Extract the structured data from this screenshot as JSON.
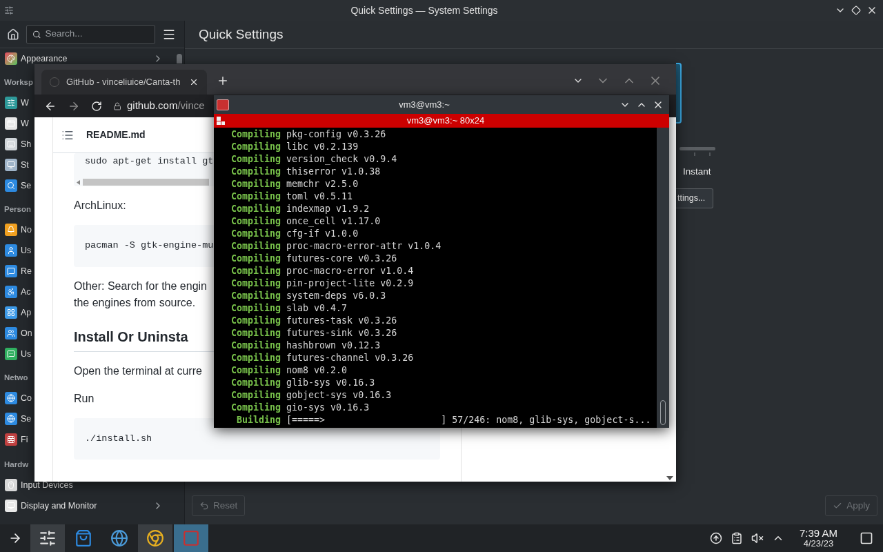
{
  "settings_window": {
    "title": "Quick Settings — System Settings",
    "search_placeholder": "Search...",
    "page_title": "Quick Settings",
    "sidebar": [
      {
        "kind": "item",
        "label": "Appearance",
        "chevron": true
      },
      {
        "kind": "heading",
        "label": "Worksp"
      },
      {
        "kind": "item",
        "label": "W"
      },
      {
        "kind": "item",
        "label": "W"
      },
      {
        "kind": "item",
        "label": "Sh"
      },
      {
        "kind": "item",
        "label": "St"
      },
      {
        "kind": "item",
        "label": "Se"
      },
      {
        "kind": "heading",
        "label": "Person"
      },
      {
        "kind": "item",
        "label": "No"
      },
      {
        "kind": "item",
        "label": "Us"
      },
      {
        "kind": "item",
        "label": "Re"
      },
      {
        "kind": "item",
        "label": "Ac"
      },
      {
        "kind": "item",
        "label": "Ap"
      },
      {
        "kind": "item",
        "label": "On"
      },
      {
        "kind": "item",
        "label": "Us"
      },
      {
        "kind": "heading",
        "label": "Netwo"
      },
      {
        "kind": "item",
        "label": "Co"
      },
      {
        "kind": "item",
        "label": "Se"
      },
      {
        "kind": "item",
        "label": "Fi"
      },
      {
        "kind": "heading",
        "label": "Hardw"
      },
      {
        "kind": "item",
        "label": "Input Devices"
      },
      {
        "kind": "item",
        "label": "Display and Monitor",
        "chevron": true
      }
    ],
    "slider_end_label": "Instant",
    "settings_button": "ttings...",
    "reset_button": {
      "label": "Reset",
      "disabled": true
    },
    "apply_button": {
      "label": "Apply",
      "disabled": true
    }
  },
  "browser": {
    "tab_title": "GitHub - vinceliuice/Canta-th",
    "url_host": "github.com",
    "url_path": "/vince",
    "file_header": "README.md",
    "blocks": [
      {
        "kind": "code",
        "text": "sudo apt-get install gt",
        "scroll": true
      },
      {
        "kind": "paragraph",
        "lines": [
          "ArchLinux:"
        ]
      },
      {
        "kind": "code",
        "text": "pacman -S gtk-engine-mu"
      },
      {
        "kind": "paragraph",
        "lines": [
          "Other: Search for the engin",
          "the engines from source."
        ]
      },
      {
        "kind": "heading",
        "text": "Install Or Uninsta"
      },
      {
        "kind": "paragraph",
        "lines": [
          "Open the terminal at curre"
        ]
      },
      {
        "kind": "paragraph",
        "lines": [
          "Run"
        ]
      },
      {
        "kind": "code",
        "text": "./install.sh"
      }
    ]
  },
  "terminal": {
    "title": "vm3@vm3:~",
    "tab_title": "vm3@vm3:~ 80x24",
    "lines": [
      {
        "verb": "Compiling",
        "text": "pkg-config v0.3.26"
      },
      {
        "verb": "Compiling",
        "text": "libc v0.2.139"
      },
      {
        "verb": "Compiling",
        "text": "version_check v0.9.4"
      },
      {
        "verb": "Compiling",
        "text": "thiserror v1.0.38"
      },
      {
        "verb": "Compiling",
        "text": "memchr v2.5.0"
      },
      {
        "verb": "Compiling",
        "text": "toml v0.5.11"
      },
      {
        "verb": "Compiling",
        "text": "indexmap v1.9.2"
      },
      {
        "verb": "Compiling",
        "text": "once_cell v1.17.0"
      },
      {
        "verb": "Compiling",
        "text": "cfg-if v1.0.0"
      },
      {
        "verb": "Compiling",
        "text": "proc-macro-error-attr v1.0.4"
      },
      {
        "verb": "Compiling",
        "text": "futures-core v0.3.26"
      },
      {
        "verb": "Compiling",
        "text": "proc-macro-error v1.0.4"
      },
      {
        "verb": "Compiling",
        "text": "pin-project-lite v0.2.9"
      },
      {
        "verb": "Compiling",
        "text": "system-deps v6.0.3"
      },
      {
        "verb": "Compiling",
        "text": "slab v0.4.7"
      },
      {
        "verb": "Compiling",
        "text": "futures-task v0.3.26"
      },
      {
        "verb": "Compiling",
        "text": "futures-sink v0.3.26"
      },
      {
        "verb": "Compiling",
        "text": "hashbrown v0.12.3"
      },
      {
        "verb": "Compiling",
        "text": "futures-channel v0.3.26"
      },
      {
        "verb": "Compiling",
        "text": "nom8 v0.2.0"
      },
      {
        "verb": "Compiling",
        "text": "glib-sys v0.16.3"
      },
      {
        "verb": "Compiling",
        "text": "gobject-sys v0.16.3"
      },
      {
        "verb": "Compiling",
        "text": "gio-sys v0.16.3"
      }
    ],
    "build": {
      "verb": "Building",
      "bar": "[=====>                     ]",
      "status": "57/246: nom8, glib-sys, gobject-s..."
    }
  },
  "taskbar": {
    "tasks": [
      {
        "open": true,
        "selected": false
      },
      {
        "open": false,
        "selected": false
      },
      {
        "open": false,
        "selected": false
      },
      {
        "open": true,
        "selected": false
      },
      {
        "open": true,
        "selected": true
      }
    ],
    "time": "7:39 AM",
    "date": "4/23/23"
  }
}
